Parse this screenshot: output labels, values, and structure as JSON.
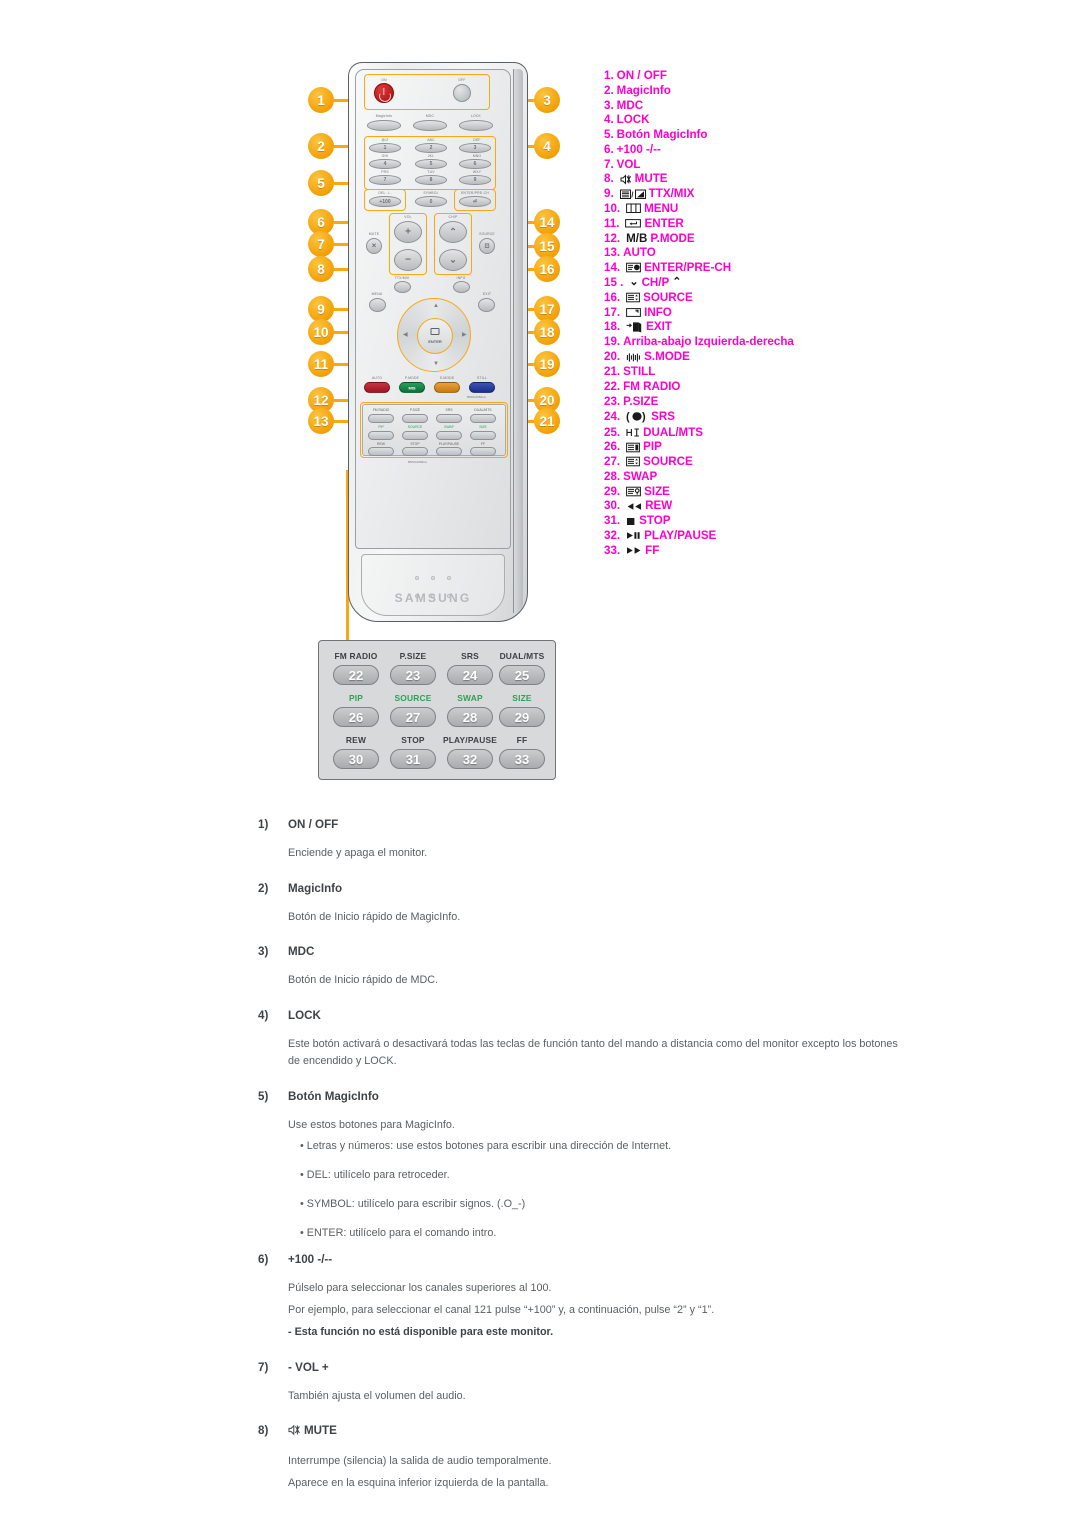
{
  "legend": {
    "items": [
      {
        "num": "1.",
        "icon": "",
        "label": "ON / OFF"
      },
      {
        "num": "2.",
        "icon": "",
        "label": "MagicInfo"
      },
      {
        "num": "3.",
        "icon": "",
        "label": "MDC"
      },
      {
        "num": "4.",
        "icon": "",
        "label": "LOCK"
      },
      {
        "num": "5.",
        "icon": "",
        "label": "Botón MagicInfo"
      },
      {
        "num": "6.",
        "icon": "",
        "label": "+100 -/--"
      },
      {
        "num": "7.",
        "icon": "",
        "label": "VOL"
      },
      {
        "num": "8.",
        "icon": "mute-icon",
        "label": "MUTE"
      },
      {
        "num": "9.",
        "icon": "ttx-mix-icon",
        "label": "TTX/MIX"
      },
      {
        "num": "10.",
        "icon": "menu-icon",
        "label": "MENU"
      },
      {
        "num": "11.",
        "icon": "enter-icon",
        "label": "ENTER"
      },
      {
        "num": "12.",
        "icon": "mb-icon",
        "label": "P.MODE"
      },
      {
        "num": "13.",
        "icon": "",
        "label": "AUTO"
      },
      {
        "num": "14.",
        "icon": "pre-ch-icon",
        "label": "ENTER/PRE-CH"
      },
      {
        "num": "15 .",
        "icon": "ch-down-icon",
        "label": "CH/P",
        "suffix": "ch-up-icon"
      },
      {
        "num": "16.",
        "icon": "source-icon",
        "label": "SOURCE"
      },
      {
        "num": "17.",
        "icon": "info-icon",
        "label": "INFO"
      },
      {
        "num": "18.",
        "icon": "exit-icon",
        "label": "EXIT"
      },
      {
        "num": "19.",
        "icon": "",
        "label": "Arriba-abajo Izquierda-derecha"
      },
      {
        "num": "20.",
        "icon": "s-mode-icon",
        "label": "S.MODE"
      },
      {
        "num": "21.",
        "icon": "",
        "label": "STILL"
      },
      {
        "num": "22.",
        "icon": "",
        "label": "FM RADIO"
      },
      {
        "num": "23.",
        "icon": "",
        "label": "P.SIZE"
      },
      {
        "num": "24.",
        "icon": "srs-icon",
        "label": "SRS"
      },
      {
        "num": "25.",
        "icon": "dual-mts-icon",
        "label": "DUAL/MTS"
      },
      {
        "num": "26.",
        "icon": "pip-icon",
        "label": "PIP"
      },
      {
        "num": "27.",
        "icon": "source2-icon",
        "label": "SOURCE"
      },
      {
        "num": "28.",
        "icon": "",
        "label": "SWAP"
      },
      {
        "num": "29.",
        "icon": "size-icon",
        "label": "SIZE"
      },
      {
        "num": "30.",
        "icon": "rew-icon",
        "label": "REW"
      },
      {
        "num": "31.",
        "icon": "stop-icon",
        "label": "STOP"
      },
      {
        "num": "32.",
        "icon": "play-pause-icon",
        "label": "PLAY/PAUSE"
      },
      {
        "num": "33.",
        "icon": "ff-icon",
        "label": "FF"
      }
    ],
    "color": "#ff00cc"
  },
  "remote": {
    "brand": "SAMSUNG",
    "top_buttons": {
      "on": "ON",
      "off": "OFF"
    },
    "function_row": [
      "MagicInfo",
      "MDC",
      "LOCK"
    ],
    "keypad_labels": [
      "@/Z",
      "ABC",
      "DEF",
      "GHI",
      "JKL",
      "MNO",
      "PRS",
      "TUV",
      "WXY"
    ],
    "keypad_keys": [
      "1",
      "2",
      "3",
      "4",
      "5",
      "6",
      "7",
      "8",
      "9"
    ],
    "key_zero": "0",
    "key_zero_label": "SYMBOL",
    "key_plus100": "+100",
    "key_plus100_label": "DEL -/--",
    "key_prech_label": "ENTER/PRE-CH",
    "vol_label": "VOL",
    "ch_label": "CH/P",
    "mute_label": "MUTE",
    "source_label": "SOURCE",
    "ttx_label": "TTX/MIX",
    "menu_label": "MENU",
    "info_label": "INFO",
    "exit_label": "EXIT",
    "enter_label": "ENTER",
    "color_buttons": [
      {
        "name": "AUTO",
        "color": "#b92430"
      },
      {
        "name": "P.MODE",
        "color": "#17884a"
      },
      {
        "name": "S.MODE",
        "color": "#d68c23"
      },
      {
        "name": "STILL",
        "color": "#2a3f9c"
      }
    ],
    "color_button_caps": [
      "AUTO",
      "P.MODE",
      "S.MODE",
      "STILL"
    ],
    "model_code": "BN59-00841A",
    "media_panel": {
      "row1_labels": [
        "FM RADIO",
        "P.SIZE",
        "SRS",
        "DUAL/MTS"
      ],
      "row2_labels": [
        "PIP",
        "SOURCE",
        "SWAP",
        "SIZE"
      ],
      "row3_labels": [
        "REW",
        "STOP",
        "PLAY/PAUSE",
        "FF"
      ]
    }
  },
  "callouts": {
    "left": [
      "1",
      "2",
      "5",
      "6",
      "7",
      "8",
      "9",
      "10",
      "11",
      "12",
      "13"
    ],
    "right": [
      "3",
      "4",
      "14",
      "15",
      "16",
      "17",
      "18",
      "19",
      "20",
      "21"
    ],
    "color": "#f9a813"
  },
  "detail_panel": {
    "rows": [
      {
        "labels": [
          "FM RADIO",
          "P.SIZE",
          "SRS",
          "DUAL/MTS"
        ],
        "numbers": [
          "22",
          "23",
          "24",
          "25"
        ],
        "green": false
      },
      {
        "labels": [
          "PIP",
          "SOURCE",
          "SWAP",
          "SIZE"
        ],
        "numbers": [
          "26",
          "27",
          "28",
          "29"
        ],
        "green": true
      },
      {
        "labels": [
          "REW",
          "STOP",
          "PLAY/PAUSE",
          "FF"
        ],
        "numbers": [
          "30",
          "31",
          "32",
          "33"
        ],
        "green": false
      }
    ]
  },
  "body": {
    "items": [
      {
        "idx": "1)",
        "title": "ON / OFF",
        "paras": [
          "Enciende y apaga el monitor."
        ]
      },
      {
        "idx": "2)",
        "title": "MagicInfo",
        "paras": [
          "Botón de Inicio rápido de MagicInfo."
        ]
      },
      {
        "idx": "3)",
        "title": "MDC",
        "paras": [
          "Botón de Inicio rápido de MDC."
        ]
      },
      {
        "idx": "4)",
        "title": "LOCK",
        "paras": [
          "Este botón activará o desactivará todas las teclas de función tanto del mando a distancia como del monitor excepto los botones de encendido y LOCK."
        ]
      },
      {
        "idx": "5)",
        "title": "Botón MagicInfo",
        "paras": [
          "Use estos botones para MagicInfo."
        ],
        "bullets": [
          "• Letras y números: use estos botones para escribir una dirección de Internet.",
          "• DEL: utilícelo para retroceder.",
          "• SYMBOL: utilícelo para escribir signos. (.O_-)",
          "• ENTER: utilícelo para el comando intro."
        ]
      },
      {
        "idx": "6)",
        "title": "+100 -/--",
        "paras": [
          "Púlselo para seleccionar los canales superiores al 100.",
          "Por ejemplo, para seleccionar el canal 121 pulse “+100” y, a continuación, pulse “2” y “1”."
        ],
        "note": "- Esta función no está disponible para este monitor."
      },
      {
        "idx": "7)",
        "title": "- VOL +",
        "paras": [
          "También ajusta el volumen del audio."
        ]
      },
      {
        "idx": "8)",
        "title": "MUTE",
        "title_icon": "mute-icon",
        "paras": [
          "Interrumpe (silencia) la salida de audio temporalmente.",
          "Aparece en la esquina inferior izquierda de la pantalla."
        ]
      }
    ]
  }
}
